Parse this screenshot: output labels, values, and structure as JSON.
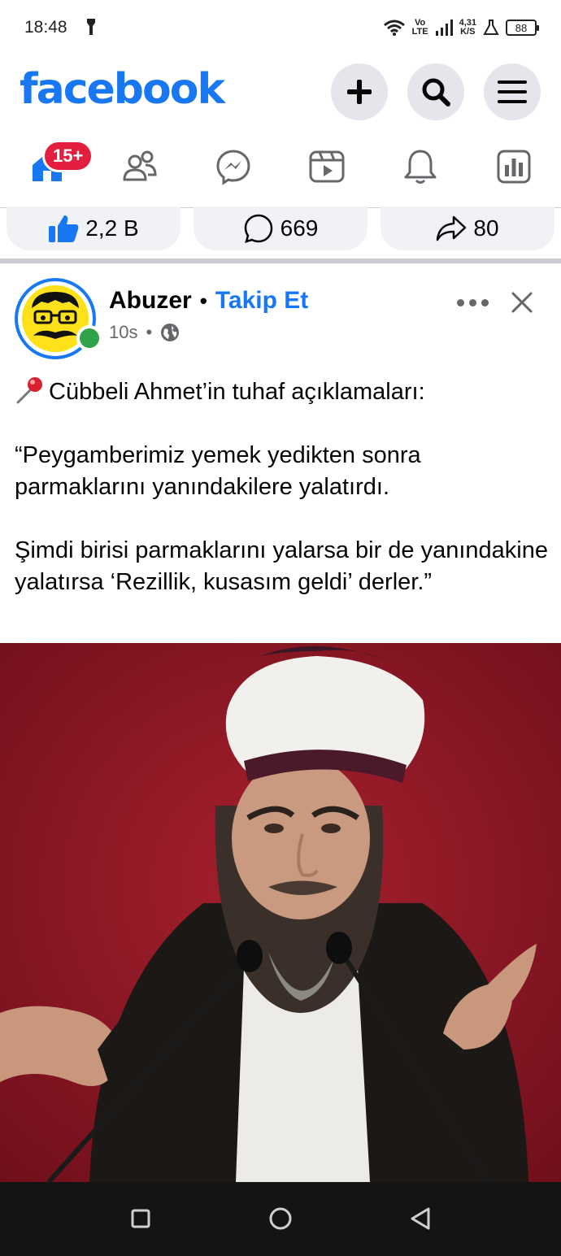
{
  "status_bar": {
    "time": "18:48",
    "network_top": "Vo",
    "network_bottom": "LTE",
    "speed_top": "4,31",
    "speed_bottom": "K/S",
    "battery": "88"
  },
  "header": {
    "logo": "facebook",
    "brand_color": "#1877f2",
    "buttons": [
      "plus-icon",
      "search-icon",
      "menu-icon"
    ]
  },
  "tabs": {
    "items": [
      "home",
      "friends",
      "messenger",
      "watch",
      "notifications",
      "dashboard"
    ],
    "notification_badge": "15+"
  },
  "previous_post_stats": {
    "likes": "2,2 B",
    "comments": "669",
    "shares": "80"
  },
  "post": {
    "author": "Abuzer",
    "separator": "•",
    "follow_label": "Takip Et",
    "time": "10s",
    "meta_separator": "•",
    "paragraphs": [
      "Cübbeli Ahmet’in tuhaf açıklamaları:",
      "",
      "“Peygamberimiz yemek yedikten sonra parmaklarını yanındakilere yalatırdı.",
      "",
      "Şimdi birisi parmaklarını yalarsa bir de yanındakine yalatırsa ‘Rezillik, kusasım geldi’ derler.”"
    ]
  },
  "colors": {
    "accent": "#1877f2",
    "badge": "#e41e3f",
    "online": "#31a24c",
    "photo_background": "#8a1424"
  }
}
